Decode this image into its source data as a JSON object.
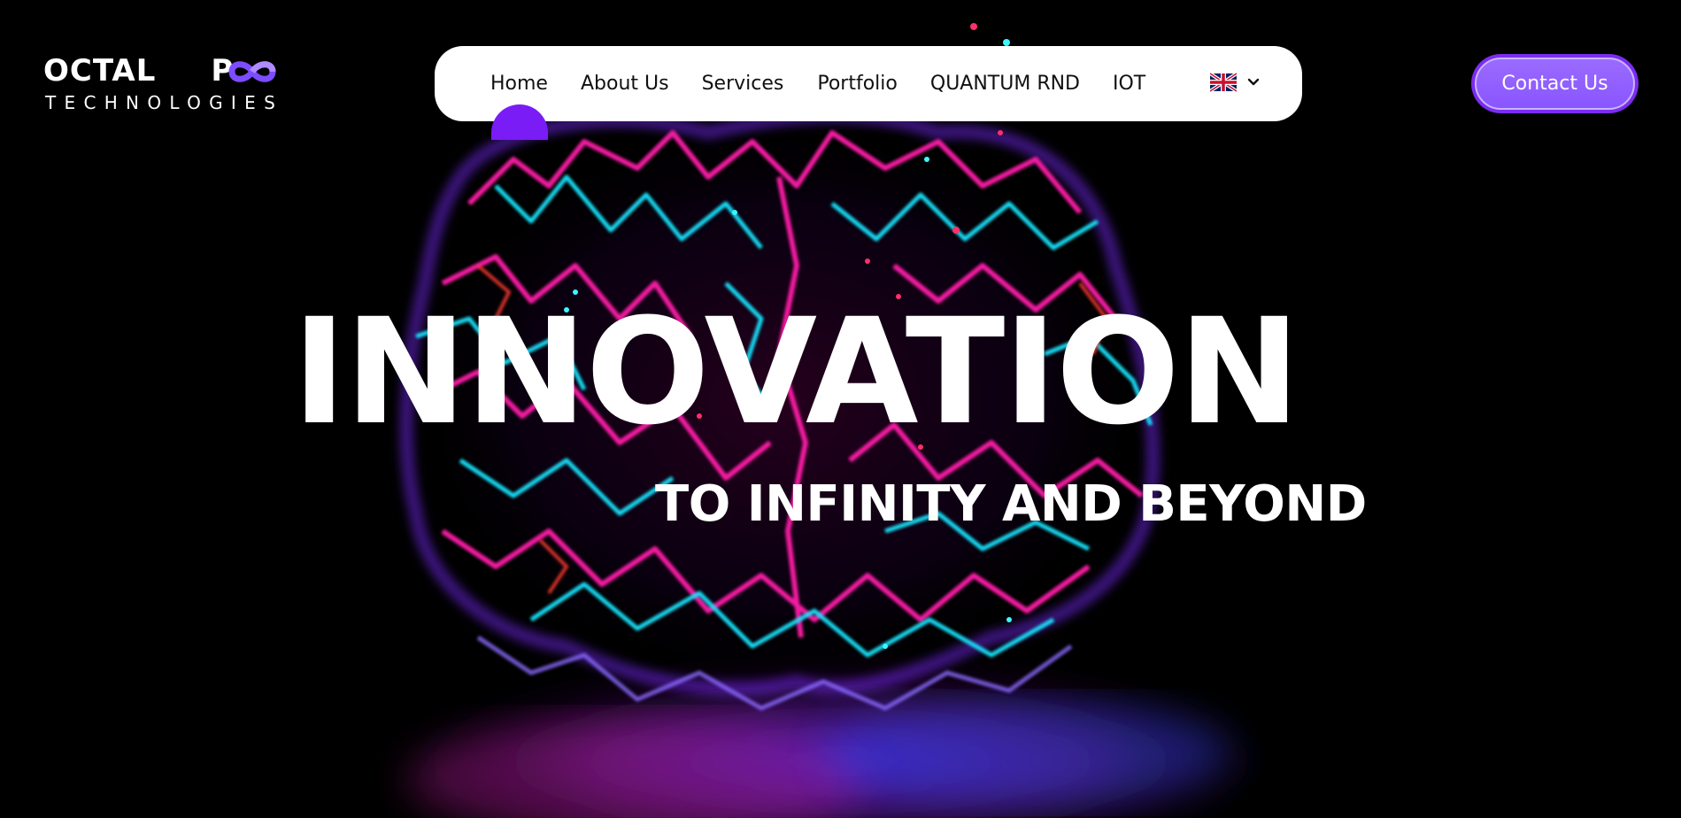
{
  "brand": {
    "name": "OCTALOOP",
    "name_before_loop": "OCTAL",
    "name_after_loop": "P",
    "subtitle": "TECHNOLOGIES",
    "loop_colors": [
      "#6a3cff",
      "#a070ff"
    ]
  },
  "nav": {
    "items": [
      {
        "label": "Home",
        "active": true
      },
      {
        "label": "About Us",
        "active": false
      },
      {
        "label": "Services",
        "active": false
      },
      {
        "label": "Portfolio",
        "active": false
      },
      {
        "label": "QUANTUM RND",
        "active": false
      },
      {
        "label": "IOT",
        "active": false
      }
    ],
    "language": {
      "flag_icon": "uk-flag-icon",
      "chevron_icon": "chevron-down-icon"
    },
    "active_color": "#7a1cf5"
  },
  "contact_button": {
    "label": "Contact Us",
    "color": "#8a55ff"
  },
  "hero": {
    "headline": "INNOVATION",
    "tagline": "TO INFINITY AND BEYOND",
    "background_image": "neon-brain-illustration",
    "palette": [
      "#00e5ff",
      "#ff1fa8",
      "#7a2cff",
      "#ff3b30"
    ]
  }
}
